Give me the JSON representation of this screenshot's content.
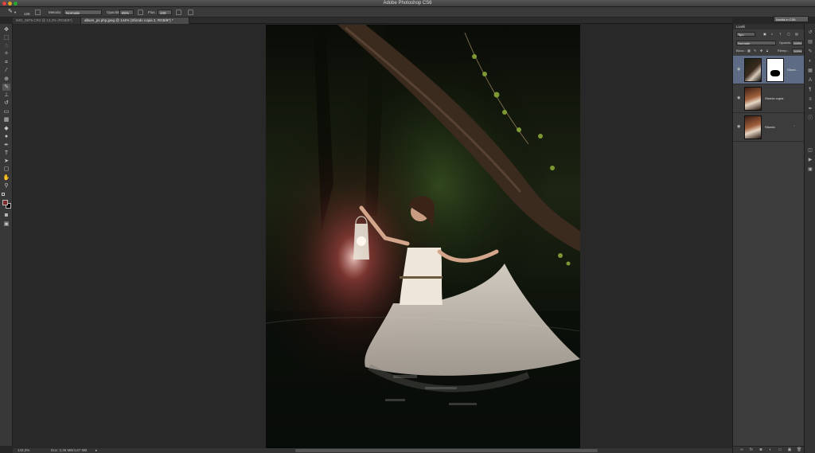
{
  "window": {
    "title": "Adobe Photoshop CS6"
  },
  "options": {
    "brush_size": "128",
    "mode_label": "Metodo:",
    "mode_value": "Normale",
    "opacity_label": "Opacità:",
    "opacity_value": "85%",
    "flow_label": "Flus.:",
    "flow_value": "100",
    "workspace": "Novità in CS6"
  },
  "tabs": [
    {
      "label": "IMG_0875.CR2 @ 13,3% (RGB/8*)"
    },
    {
      "label": "album_ps.php.jpeg @ 144% (Sfondo copia 2, RGB/8*) *"
    }
  ],
  "status": {
    "zoom": "143,3%",
    "doc_info": "Doc: 2,36 MB/4,67 MB",
    "canvas_label": "Sfondo"
  },
  "layers_panel": {
    "title": "Livelli",
    "filter": "Tipo",
    "blend_mode": "Normale",
    "opacity_label": "Opacità:",
    "opacity_value": "100%",
    "lock_label": "Blocc.:",
    "fill_label": "Riemp.:",
    "fill_value": "100%",
    "layers": [
      {
        "name": "Sfond...",
        "selected": true
      },
      {
        "name": "Sfondo copia",
        "selected": false
      },
      {
        "name": "Sfondo",
        "selected": false
      }
    ]
  },
  "colors": {
    "accent": "#5d6b84",
    "foreground_swatch": "#7a2a2a",
    "background_swatch": "#000000"
  }
}
